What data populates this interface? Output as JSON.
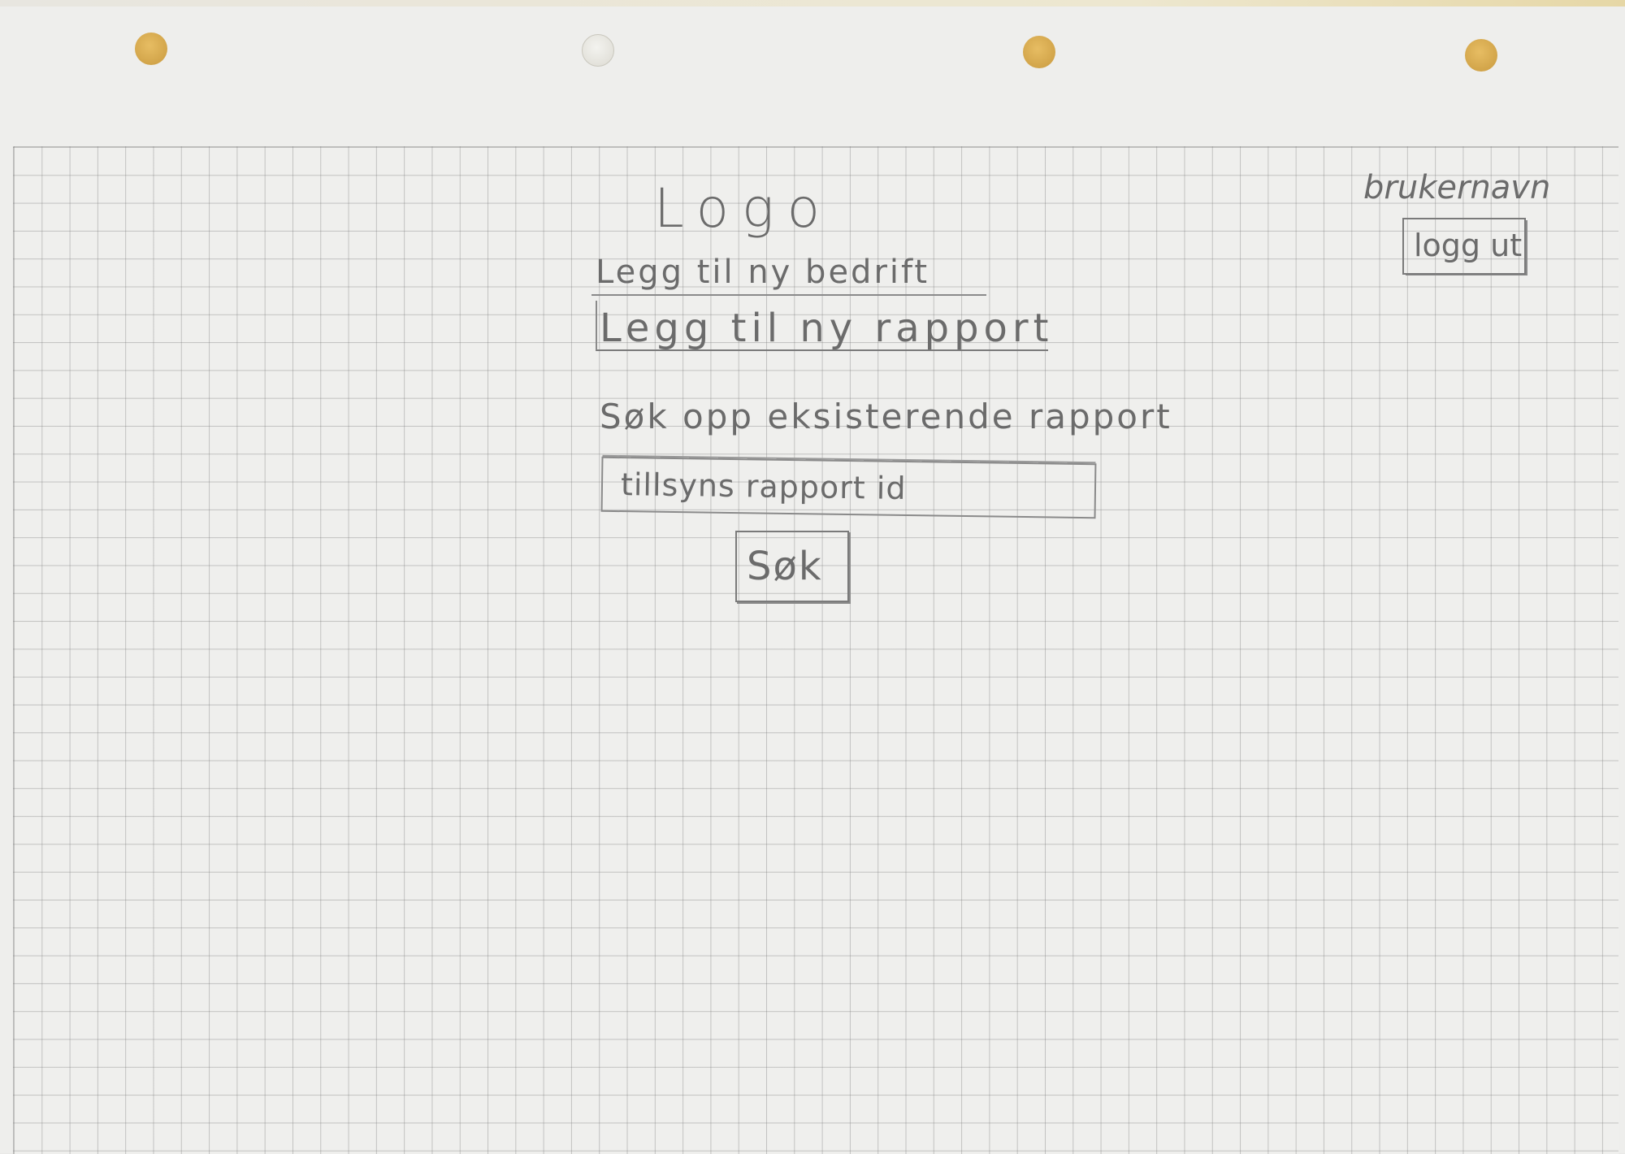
{
  "header": {
    "logo_text": "Logo",
    "username": "brukernavn",
    "logout_label": "logg ut"
  },
  "actions": {
    "add_company": "Legg til ny bedrift",
    "add_report": "Legg til ny rapport"
  },
  "search": {
    "heading": "Søk opp eksisterende rapport",
    "input_placeholder": "tillsyns rapport id",
    "button_label": "Søk"
  }
}
